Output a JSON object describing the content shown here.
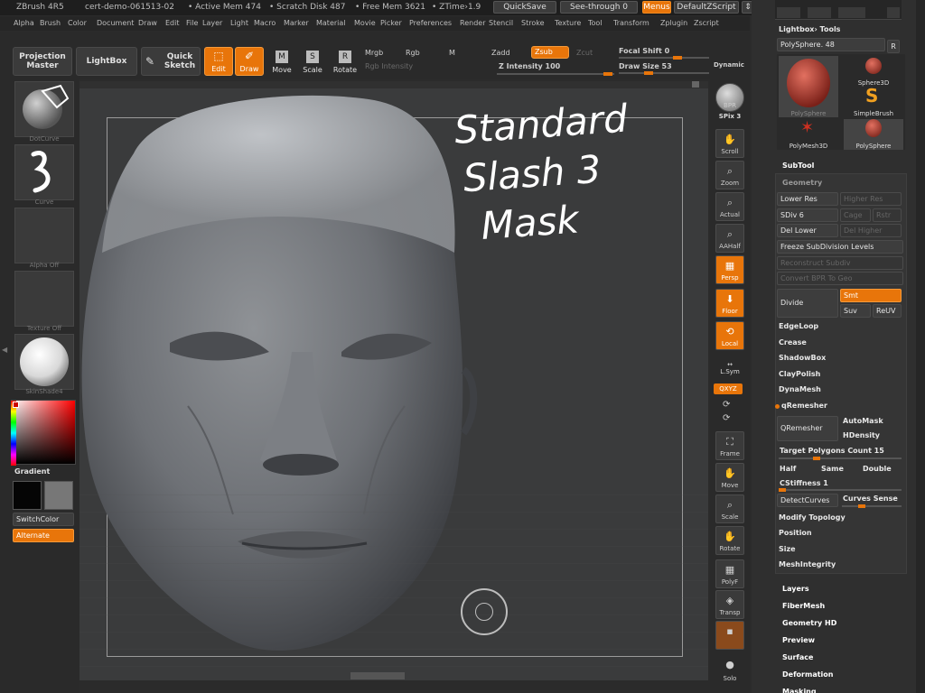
{
  "titlebar": {
    "app": "ZBrush 4R5",
    "doc": "cert-demo-061513-02",
    "active_mem": "• Active Mem 474",
    "scratch": "• Scratch Disk 487",
    "free_mem": "• Free Mem 3621",
    "ztime": "• ZTime›1.9",
    "quicksave": "QuickSave",
    "seethrough": "See-through  0",
    "menus": "Menus",
    "script": "DefaultZScript"
  },
  "menubar": [
    "Alpha",
    "Brush",
    "Color",
    "Document",
    "Draw",
    "Edit",
    "File",
    "Layer",
    "Light",
    "Macro",
    "Marker",
    "Material",
    "Movie",
    "Picker",
    "Preferences",
    "Render",
    "Stencil",
    "Stroke",
    "Texture",
    "Tool",
    "Transform",
    "Zplugin",
    "Zscript"
  ],
  "toolbar": {
    "projection_master": "Projection Master",
    "lightbox": "LightBox",
    "quick_sketch": "Quick Sketch",
    "edit": "Edit",
    "draw": "Draw",
    "move": "Move",
    "scale": "Scale",
    "rotate": "Rotate",
    "mrgb": "Mrgb",
    "rgb": "Rgb",
    "m": "M",
    "rgb_intensity": "Rgb Intensity",
    "zadd": "Zadd",
    "zsub": "Zsub",
    "zcut": "Zcut",
    "z_intensity": "Z Intensity 100",
    "focal_shift": "Focal Shift 0",
    "draw_size": "Draw Size 53",
    "dynamic": "Dynamic"
  },
  "leftshelf": {
    "stroke_caption": "DotCurve",
    "curve_caption": "Curve",
    "alpha_caption": "Alpha Off",
    "texture_caption": "Texture Off",
    "material_caption": "SkinShade4",
    "gradient": "Gradient",
    "switch_color": "SwitchColor",
    "alternate": "Alternate"
  },
  "canvas": {
    "note_line1": "Standard",
    "note_line2": "Slash 3",
    "note_line3": "Mask"
  },
  "rightshelf": {
    "bpr": "BPR",
    "spix": "SPix 3",
    "scroll": "Scroll",
    "zoom": "Zoom",
    "actual": "Actual",
    "aahalf": "AAHalf",
    "persp": "Persp",
    "floor": "Floor",
    "local": "Local",
    "lsym": "L.Sym",
    "xyz": "QXYZ",
    "frame": "Frame",
    "move": "Move",
    "scale": "Scale",
    "rotate": "Rotate",
    "polyf": "PolyF",
    "transp": "Transp",
    "solo": "Solo"
  },
  "panel": {
    "lightbox_tools": "Lightbox› Tools",
    "polysphere_slider": "PolySphere. 48",
    "r_button": "R",
    "tool_thumbs": [
      "PolySphere",
      "Sphere3D",
      "SimpleBrush",
      "PolyMesh3D",
      "PolySphere"
    ],
    "subtool": "SubTool",
    "geometry": "Geometry",
    "lower_res": "Lower Res",
    "higher_res": "Higher Res",
    "sdiv": "SDiv 6",
    "cage": "Cage",
    "rstr": "Rstr",
    "del_lower": "Del Lower",
    "del_higher": "Del Higher",
    "freeze_subdiv": "Freeze SubDivision Levels",
    "reconstruct_subdiv": "Reconstruct Subdiv",
    "convert_bpr": "Convert BPR To Geo",
    "divide": "Divide",
    "smt": "Smt",
    "suv": "Suv",
    "reuv": "ReUV",
    "edgeloop": "EdgeLoop",
    "crease": "Crease",
    "shadowbox": "ShadowBox",
    "claypolish": "ClayPolish",
    "dynamesh": "DynaMesh",
    "qremesher_hdr": "qRemesher",
    "qremesher_btn": "QRemesher",
    "automask": "AutoMask",
    "hdensity": "HDensity",
    "target_polys": "Target Polygons Count 15",
    "half": "Half",
    "same": "Same",
    "double": "Double",
    "cstiffness": "CStiffness 1",
    "detect_curves": "DetectCurves",
    "curves_sense": "Curves Sense",
    "modify_topology": "Modify Topology",
    "position": "Position",
    "size": "Size",
    "meshintegrity": "MeshIntegrity",
    "layers": "Layers",
    "fibermesh": "FiberMesh",
    "geometry_hd": "Geometry HD",
    "preview": "Preview",
    "surface": "Surface",
    "deformation": "Deformation",
    "masking": "Masking"
  },
  "colors": {
    "accent": "#e8750a",
    "panel_bg": "#2f2f2f",
    "canvas_bg": "#3a3b3c"
  }
}
